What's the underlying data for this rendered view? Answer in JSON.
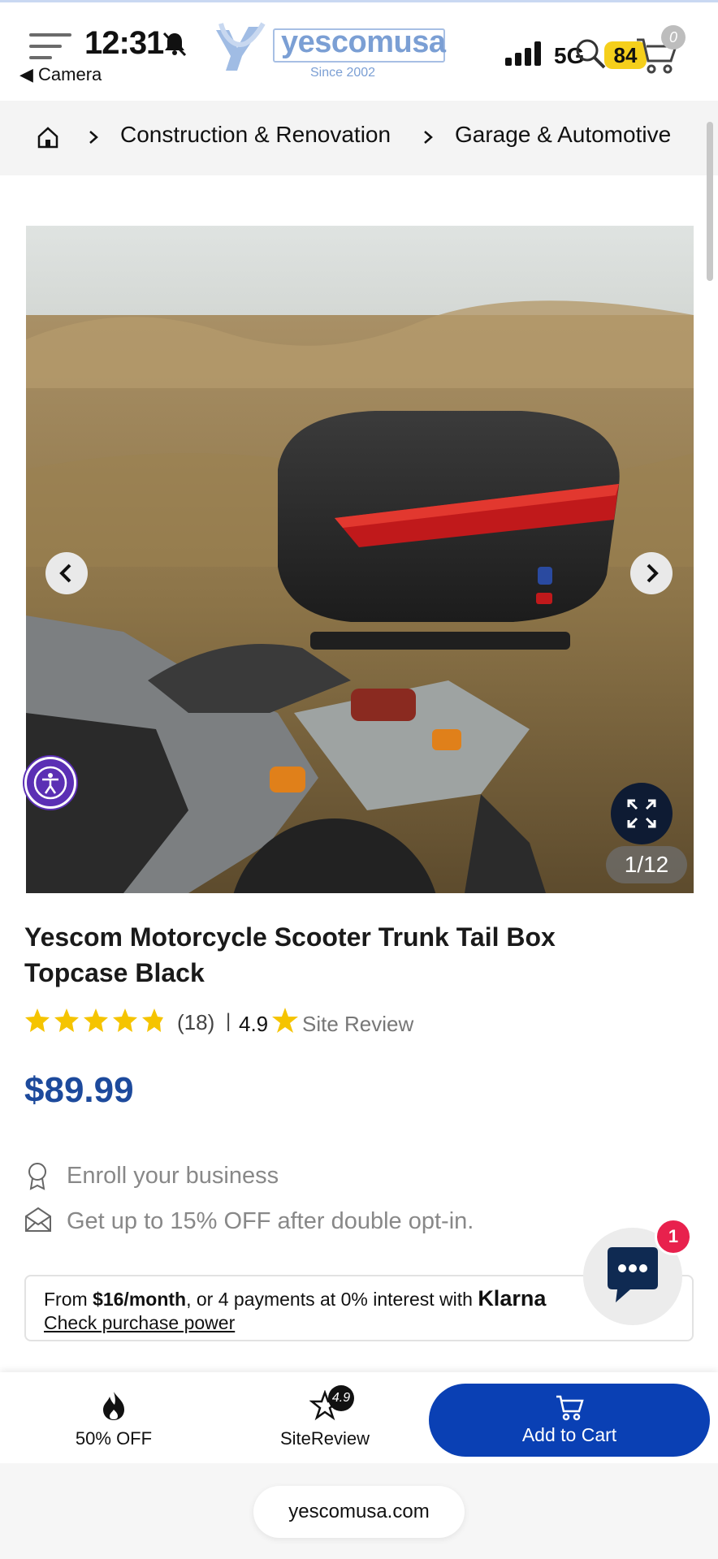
{
  "status_bar": {
    "time": "12:31",
    "back_app": "Camera",
    "network": "5G",
    "battery": "84",
    "network_overlay": "U"
  },
  "header": {
    "logo_text": "yescomusa",
    "logo_tagline": "Since 2002",
    "cart_count": "0"
  },
  "breadcrumb": {
    "items": [
      "Construction & Renovation",
      "Garage & Automotive"
    ]
  },
  "gallery": {
    "counter": "1/12"
  },
  "product": {
    "title_line1": "Yescom Motorcycle Scooter Trunk Tail Box",
    "title_line2": "Topcase Black",
    "review_count": "(18)",
    "separator": "|",
    "site_score": "4.9",
    "site_review_label": "Site Review",
    "price": "$89.99",
    "rating": 5
  },
  "perks": [
    {
      "icon": "award-icon",
      "text": "Enroll your business"
    },
    {
      "icon": "envelope-icon",
      "text": "Get up to 15% OFF after double opt-in."
    }
  ],
  "klarna": {
    "prefix": "From ",
    "amount": "$16/month",
    "middle": ", or 4 payments at 0% interest with ",
    "brand": "Klarna",
    "link": "Check purchase power"
  },
  "chat": {
    "badge": "1"
  },
  "action_bar": {
    "deal_label": "50% OFF",
    "site_review_label": "SiteReview",
    "site_review_badge": "4.9",
    "add_to_cart_label": "Add to Cart"
  },
  "browser": {
    "url": "yescomusa.com"
  },
  "colors": {
    "brand_blue": "#0a40b4",
    "price_blue": "#1d4a9c",
    "star_yellow": "#f5c400",
    "chat_badge_red": "#e8214d"
  }
}
